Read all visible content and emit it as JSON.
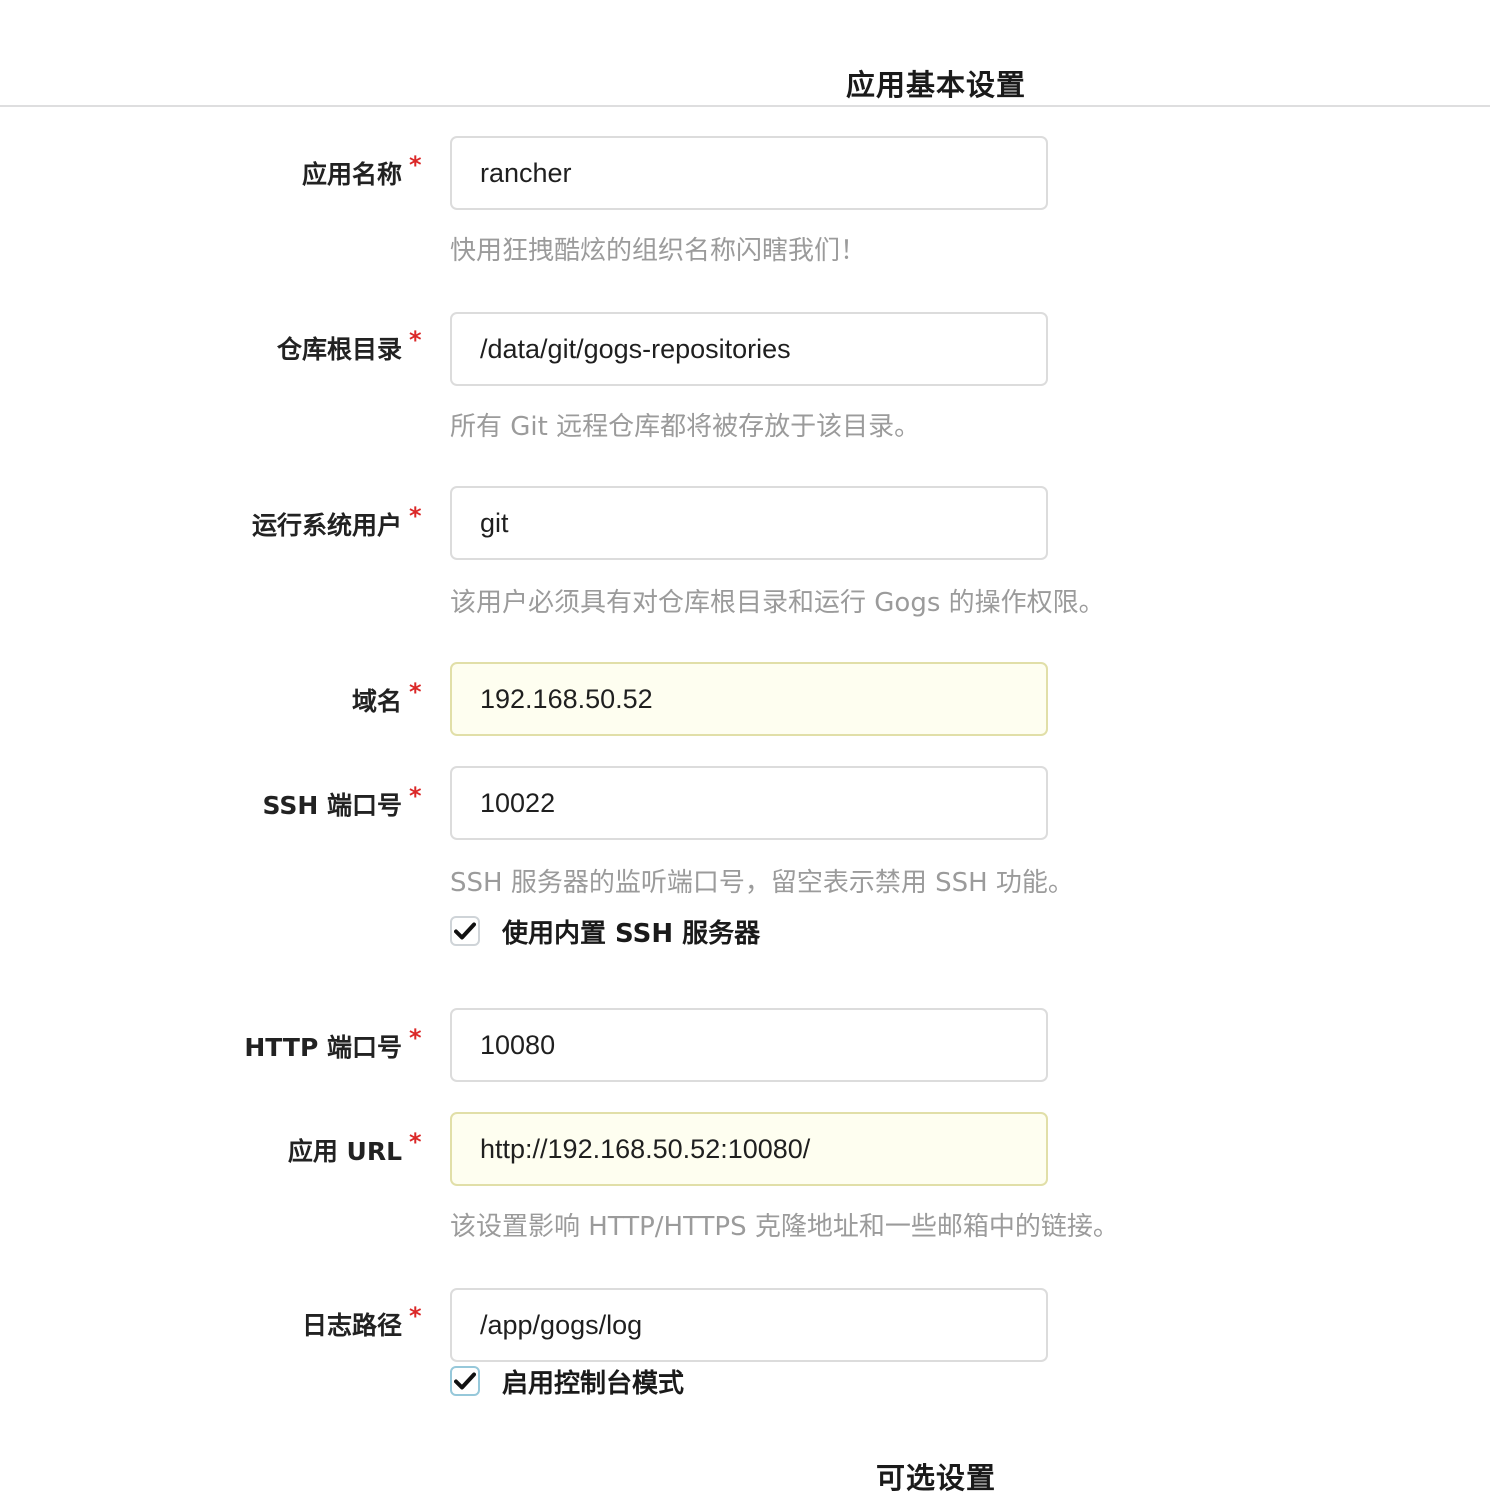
{
  "section": {
    "title": "应用基本设置",
    "next_title": "可选设置"
  },
  "fields": {
    "app_name": {
      "label": "应用名称",
      "required": "*",
      "value": "rancher",
      "help": "快用狂拽酷炫的组织名称闪瞎我们！"
    },
    "repo_root": {
      "label": "仓库根目录",
      "required": "*",
      "value": "/data/git/gogs-repositories",
      "help": "所有 Git 远程仓库都将被存放于该目录。"
    },
    "run_user": {
      "label": "运行系统用户",
      "required": "*",
      "value": "git",
      "help": "该用户必须具有对仓库根目录和运行 Gogs 的操作权限。"
    },
    "domain": {
      "label": "域名",
      "required": "*",
      "value": "192.168.50.52"
    },
    "ssh_port": {
      "label": "SSH 端口号",
      "required": "*",
      "value": "10022",
      "help": "SSH 服务器的监听端口号，留空表示禁用 SSH 功能。",
      "checkbox_label": "使用内置 SSH 服务器",
      "checkbox_checked": true
    },
    "http_port": {
      "label": "HTTP 端口号",
      "required": "*",
      "value": "10080"
    },
    "app_url": {
      "label": "应用 URL",
      "required": "*",
      "value": "http://192.168.50.52:10080/",
      "help": "该设置影响 HTTP/HTTPS 克隆地址和一些邮箱中的链接。"
    },
    "log_path": {
      "label": "日志路径",
      "required": "*",
      "value": "/app/gogs/log",
      "checkbox_label": "启用控制台模式",
      "checkbox_checked": true
    }
  },
  "colors": {
    "required_star": "#db2828",
    "help_text": "#9b9b9b",
    "autofill_bg": "#fefef0"
  }
}
